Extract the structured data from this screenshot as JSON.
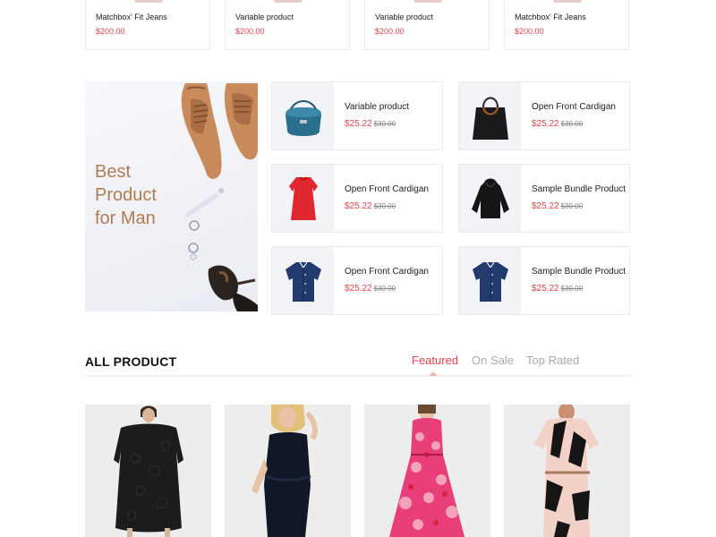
{
  "top_products": [
    {
      "name": "Matchbox' Fit Jeans",
      "price": "$200.00"
    },
    {
      "name": "Variable product",
      "price": "$200.00"
    },
    {
      "name": "Variable product",
      "price": "$200.00"
    },
    {
      "name": "Matchbox' Fit Jeans",
      "price": "$200.00"
    }
  ],
  "banner": {
    "line1": "Best",
    "line2": "Product",
    "line3": "for Man"
  },
  "side_products": [
    {
      "title": "Variable product",
      "price": "$25.22",
      "old_price": "$30.00",
      "icon": "blue-bag-icon"
    },
    {
      "title": "Open Front Cardigan",
      "price": "$25.22",
      "old_price": "$30.00",
      "icon": "black-tote-icon"
    },
    {
      "title": "Open Front Cardigan",
      "price": "$25.22",
      "old_price": "$30.00",
      "icon": "red-dress-icon"
    },
    {
      "title": "Sample Bundle Product",
      "price": "$25.22",
      "old_price": "$30.00",
      "icon": "black-hoodie-icon"
    },
    {
      "title": "Open Front Cardigan",
      "price": "$25.22",
      "old_price": "$30.00",
      "icon": "navy-shirt-icon"
    },
    {
      "title": "Sample Bundle Product",
      "price": "$25.22",
      "old_price": "$30.00",
      "icon": "navy-shirt-icon"
    }
  ],
  "all_product": {
    "title": "ALL PRODUCT",
    "tabs": [
      "Featured",
      "On Sale",
      "Top Rated"
    ],
    "active_tab": "Featured"
  },
  "colors": {
    "accent": "#e8434b",
    "banner_text": "#b27a52"
  }
}
